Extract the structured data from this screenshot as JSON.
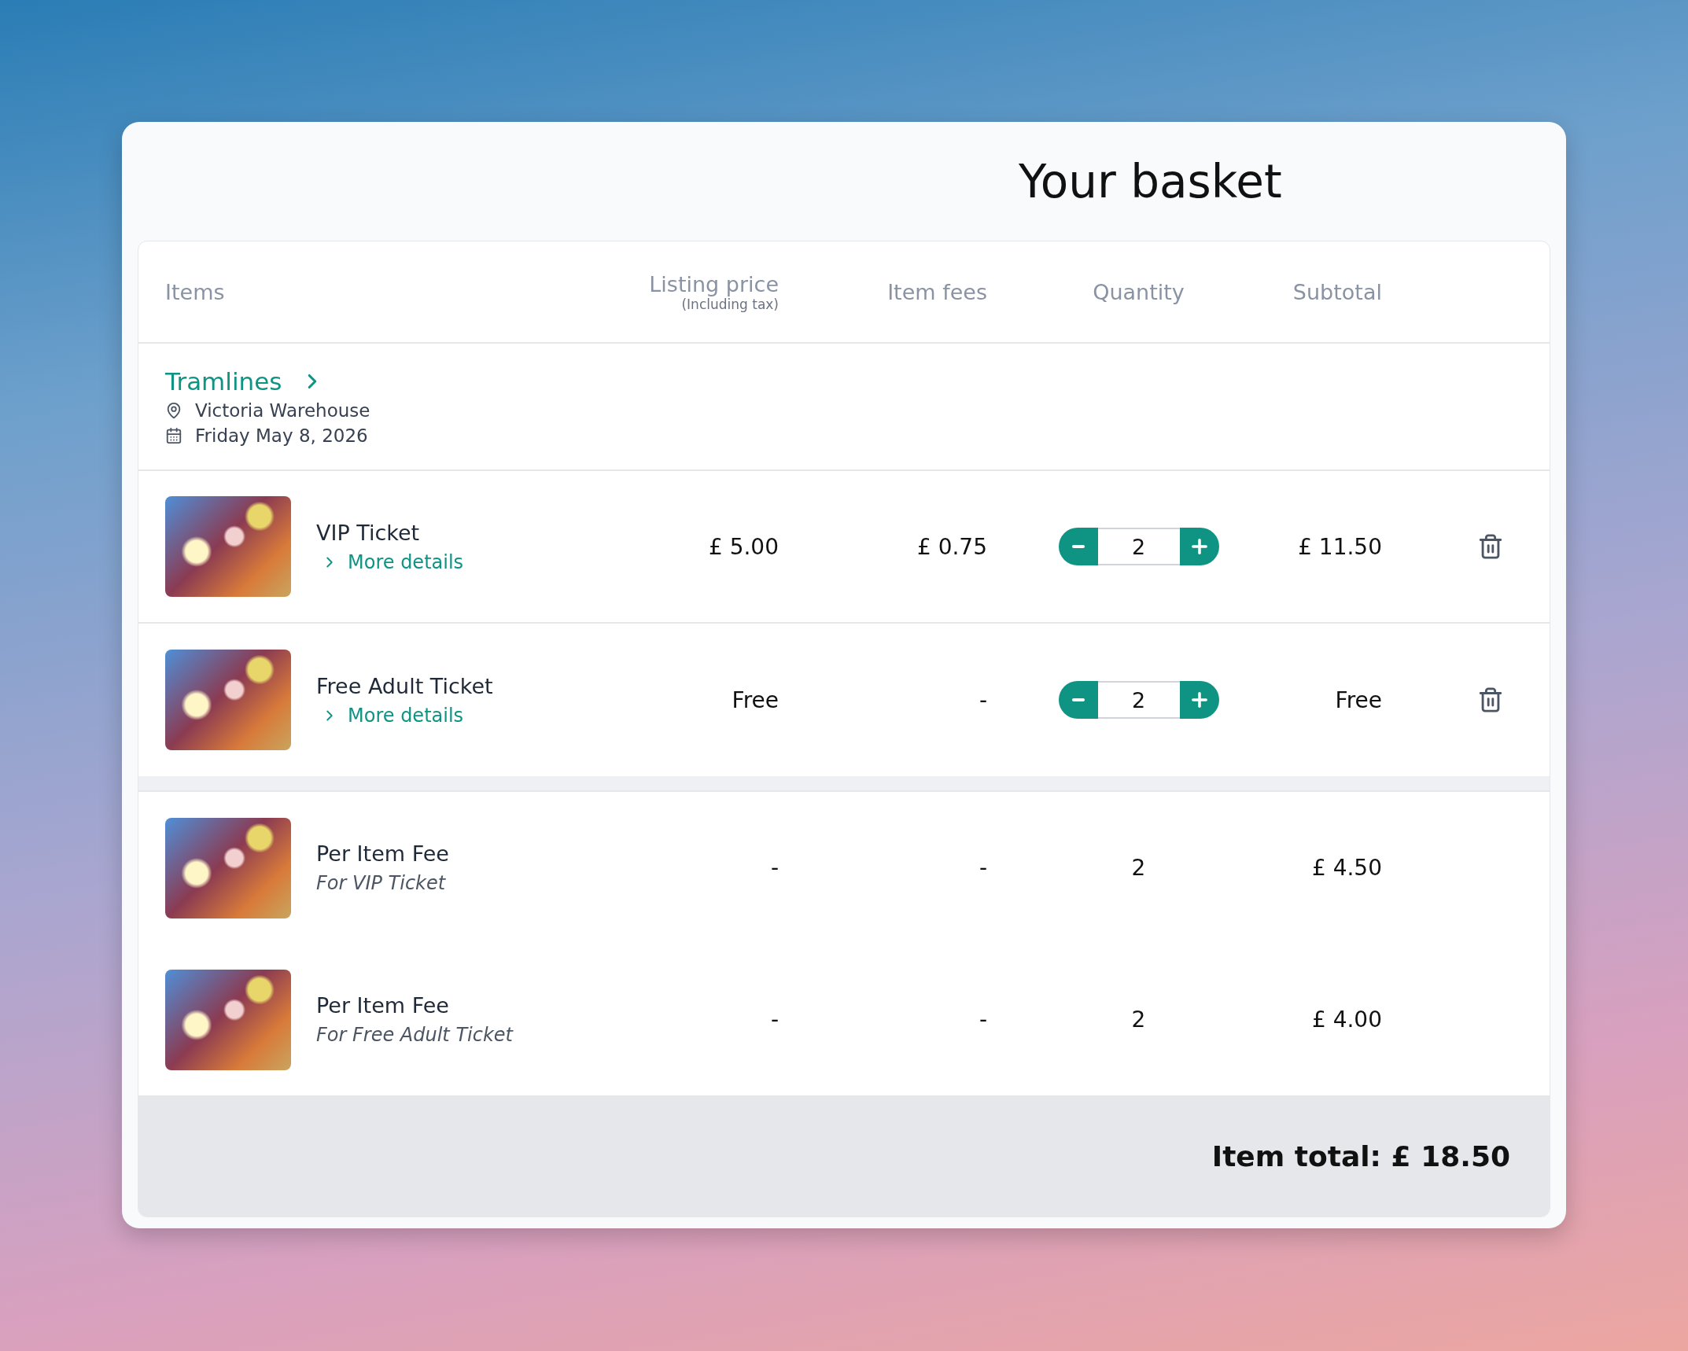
{
  "title": "Your basket",
  "columns": [
    {
      "label": "Items"
    },
    {
      "label": "Listing price",
      "note": "(Including tax)"
    },
    {
      "label": "Item fees"
    },
    {
      "label": "Quantity"
    },
    {
      "label": "Subtotal"
    }
  ],
  "event": {
    "name": "Tramlines",
    "venue": "Victoria Warehouse",
    "date": "Friday May 8, 2026"
  },
  "tickets": [
    {
      "name": "VIP Ticket",
      "link": "More details",
      "price": "£ 5.00",
      "fees": "£ 0.75",
      "quantity": "2",
      "subtotal": "£ 11.50"
    },
    {
      "name": "Free Adult Ticket",
      "link": "More details",
      "price": "Free",
      "fees": "-",
      "quantity": "2",
      "subtotal": "Free"
    }
  ],
  "fee_rows": [
    {
      "name": "Per Item Fee",
      "note": "For VIP Ticket",
      "price": "-",
      "fees": "-",
      "quantity": "2",
      "subtotal": "£ 4.50"
    },
    {
      "name": "Per Item Fee",
      "note": "For Free Adult Ticket",
      "price": "-",
      "fees": "-",
      "quantity": "2",
      "subtotal": "£ 4.00"
    }
  ],
  "total": "Item total: £ 18.50"
}
